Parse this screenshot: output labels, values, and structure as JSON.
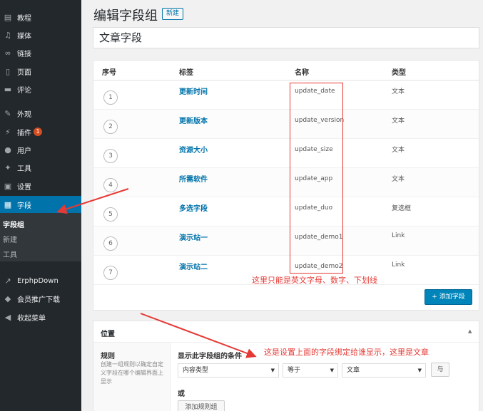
{
  "sidebar": {
    "items": [
      {
        "label": "教程",
        "icon": "tutorial-icon",
        "glyph": "▤"
      },
      {
        "label": "媒体",
        "icon": "media-icon",
        "glyph": "♫"
      },
      {
        "label": "链接",
        "icon": "link-icon",
        "glyph": "∞"
      },
      {
        "label": "页面",
        "icon": "page-icon",
        "glyph": "▯"
      },
      {
        "label": "评论",
        "icon": "comment-icon",
        "glyph": "▬"
      },
      {
        "label": "外观",
        "icon": "appearance-icon",
        "glyph": "✎"
      },
      {
        "label": "插件",
        "icon": "plugin-icon",
        "glyph": "⚡",
        "badge": "1"
      },
      {
        "label": "用户",
        "icon": "user-icon",
        "glyph": "●"
      },
      {
        "label": "工具",
        "icon": "tool-icon",
        "glyph": "✦"
      },
      {
        "label": "设置",
        "icon": "settings-icon",
        "glyph": "▣"
      },
      {
        "label": "字段",
        "icon": "fields-icon",
        "glyph": "▦",
        "active": true
      }
    ],
    "submenu": [
      "字段组",
      "新建",
      "工具"
    ],
    "bottom_items": [
      {
        "label": "ErphpDown",
        "icon": "erphpdown-icon",
        "glyph": "↗"
      },
      {
        "label": "会员推广下载",
        "icon": "shield-icon",
        "glyph": "◆"
      },
      {
        "label": "收起菜单",
        "icon": "collapse-icon",
        "glyph": "◀"
      }
    ]
  },
  "header": {
    "title": "编辑字段组",
    "add_new": "新建"
  },
  "group_title": "文章字段",
  "fields_table": {
    "columns": [
      "序号",
      "标签",
      "名称",
      "类型"
    ],
    "rows": [
      {
        "order": "1",
        "label": "更新时间",
        "name": "update_date",
        "type": "文本"
      },
      {
        "order": "2",
        "label": "更新版本",
        "name": "update_version",
        "type": "文本"
      },
      {
        "order": "3",
        "label": "资源大小",
        "name": "update_size",
        "type": "文本"
      },
      {
        "order": "4",
        "label": "所需软件",
        "name": "update_app",
        "type": "文本"
      },
      {
        "order": "5",
        "label": "多选字段",
        "name": "update_duo",
        "type": "复选框"
      },
      {
        "order": "6",
        "label": "演示站一",
        "name": "update_demo1",
        "type": "Link"
      },
      {
        "order": "7",
        "label": "演示站二",
        "name": "update_demo2",
        "type": "Link"
      }
    ],
    "add_field": "+ 添加字段"
  },
  "annotations": {
    "name_note": "这里只能是英文字母、数字、下划线",
    "location_note": "这是设置上面的字段绑定给谁显示，这里是文章"
  },
  "location": {
    "title": "位置",
    "rules_title": "规则",
    "rules_desc": "创建一组规则以确定自定义字段在哪个编辑界面上显示",
    "condition_title": "显示此字段组的条件",
    "param": "内容类型",
    "operator": "等于",
    "value": "文章",
    "and_label": "与",
    "or_label": "或",
    "add_rule_group": "添加规则组"
  },
  "colors": {
    "accent": "#0073aa",
    "sidebar": "#23282d",
    "annotation": "#e53935"
  }
}
